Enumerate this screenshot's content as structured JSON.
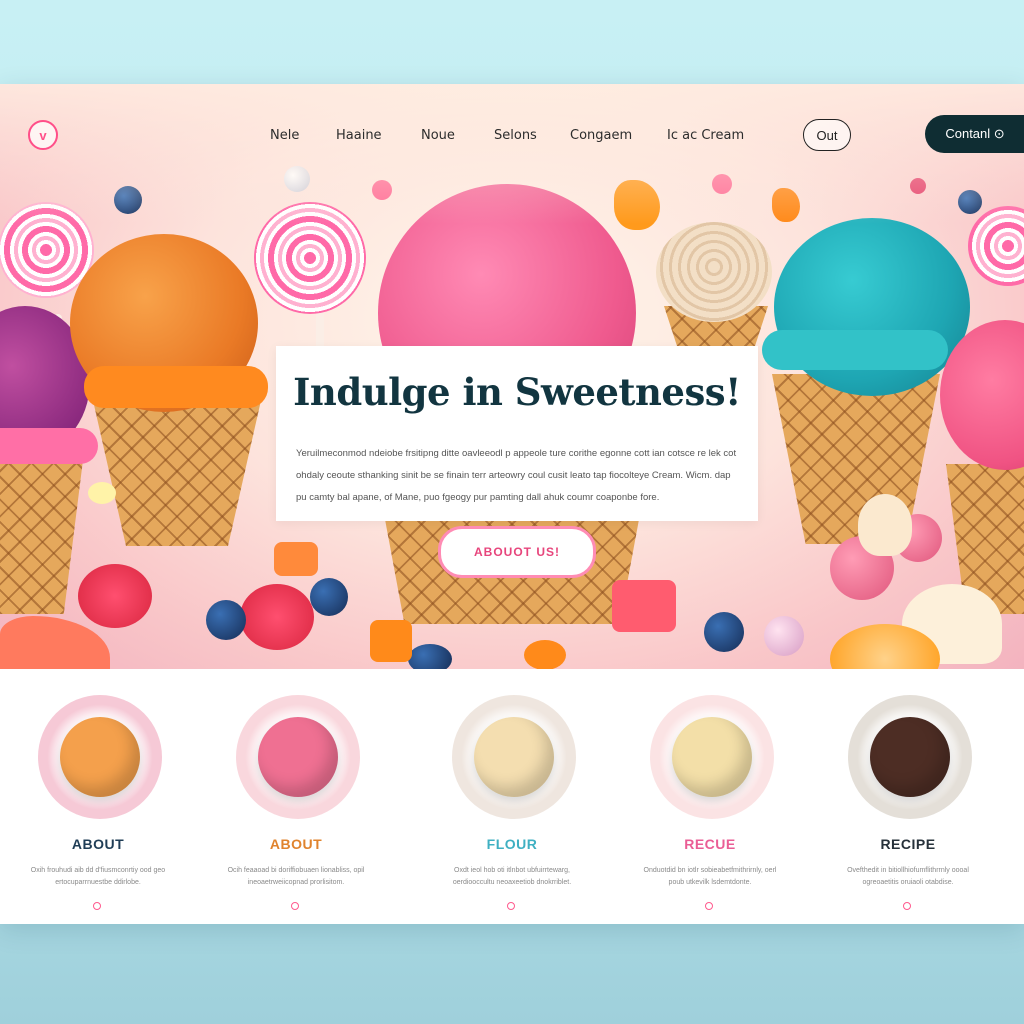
{
  "nav": {
    "logo": "v",
    "links": [
      "Nele",
      "Haaine",
      "Noue",
      "Selons",
      "Congaem",
      "Ic ac  Cream"
    ],
    "out_label": "Out",
    "contact_label": "Contanl ⊙"
  },
  "hero": {
    "title": "Indulge in Sweetness!",
    "body": "Yeruilmeconmod ndeiobe frsitipng ditte oavleeodl p appeole ture corithe egonne cott ian cotsce re lek cot ohdaly ceoute sthanking sinit be se finain terr arteowry coul cusit leato tap fiocolteye Cream. Wicm. dap pu camty bal apane, of Mane, puo fgeogy pur pamting dall ahuk coumr coaponbe fore.",
    "button_label": "ABOUOT US!"
  },
  "features": [
    {
      "title": "ABOUT",
      "text": "Oxih frouhudi aib dd d'fiusmconrtiy ood geo ertocuparrnuestbe ddirlobe.",
      "title_color": "#1f3d56",
      "scoop_color": "#f4a04c",
      "bg_color": "#f6c9d6"
    },
    {
      "title": "ABOUT",
      "text": "Ocih feaaoad bi doriffiobuaen lionabliss, opil ineoaetrweiicopnad prorlisitom.",
      "title_color": "#e0832d",
      "scoop_color": "#ef7092",
      "bg_color": "#f9d7dd"
    },
    {
      "title": "FLOUR",
      "text": "Oxdt ieol hob oti itlnbot ubfuirrtewarg, oerdiooccultu neoaxeetiob dnokrriblet.",
      "title_color": "#3fb0c2",
      "scoop_color": "#f4deb0",
      "bg_color": "#efe6df"
    },
    {
      "title": "RECUE",
      "text": "Onduotdid bn iotlr sobieabetfmithrirnly, oerl poub utkevilk lsdemtdonte.",
      "title_color": "#ea5d95",
      "scoop_color": "#f3dfa8",
      "bg_color": "#fbe3e4"
    },
    {
      "title": "RECIPE",
      "text": "Ovefthedit in bitiollhiofumflithrrnly oooal ogreoaetitis oruiaoli otabdise.",
      "title_color": "#26313a",
      "scoop_color": "#4d2d24",
      "bg_color": "#e4dfd8"
    }
  ],
  "colors": {
    "accent_pink": "#ff4f89",
    "dark_teal": "#0f2d33",
    "title_navy": "#123540"
  }
}
